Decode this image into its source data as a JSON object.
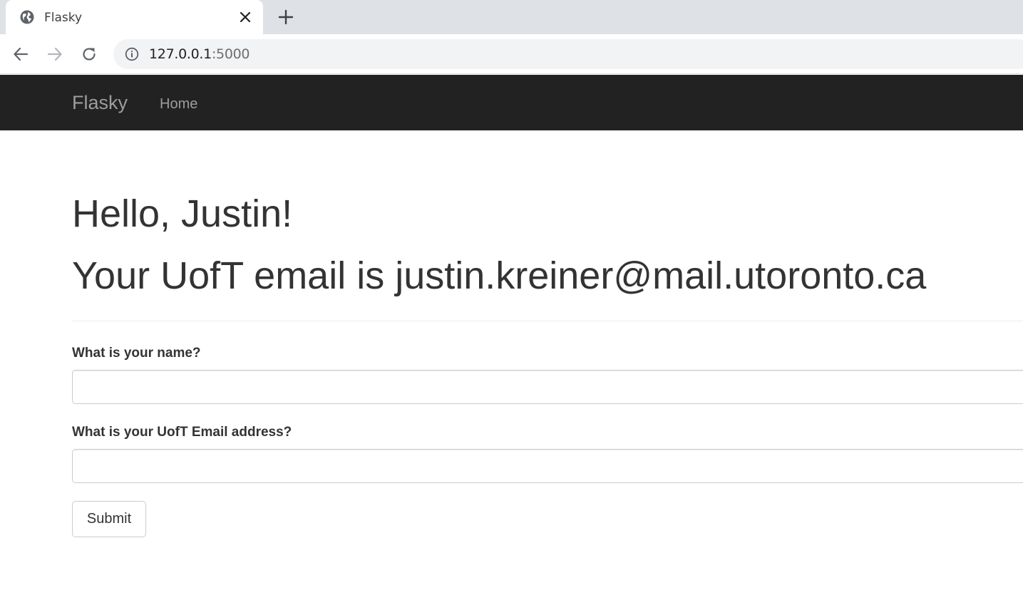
{
  "browser": {
    "tab_title": "Flasky",
    "url_host": "127.0.0.1",
    "url_port": ":5000",
    "icons": [
      "globe-icon",
      "close-icon",
      "plus-icon",
      "back-arrow-icon",
      "forward-arrow-icon",
      "reload-icon",
      "info-icon"
    ]
  },
  "navbar": {
    "brand": "Flasky",
    "links": [
      {
        "label": "Home"
      }
    ]
  },
  "main": {
    "greeting": "Hello, Justin!",
    "email_line": "Your UofT email is justin.kreiner@mail.utoronto.ca"
  },
  "form": {
    "name_label": "What is your name?",
    "name_value": "",
    "email_label": "What is your UofT Email address?",
    "email_value": "",
    "submit_label": "Submit"
  },
  "colors": {
    "navbar_bg": "#222222",
    "nav_text": "#9d9d9d",
    "heading_text": "#333333",
    "tabstrip_bg": "#dee1e6"
  }
}
